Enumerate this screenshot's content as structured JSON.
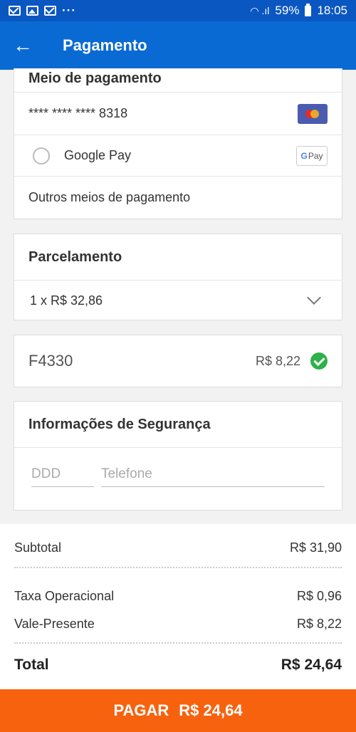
{
  "status_bar": {
    "dots": "···",
    "battery_percent": "59%",
    "time": "18:05"
  },
  "app_bar": {
    "back_icon": "←",
    "title": "Pagamento"
  },
  "payment_methods": {
    "section_title": "Meio de pagamento",
    "card_number": "**** **** **** 8318",
    "card_brand_icon": "mastercard-icon",
    "google_pay_label": "Google Pay",
    "google_pay_badge_g": "G",
    "google_pay_badge_text": "Pay",
    "others_label": "Outros meios de pagamento"
  },
  "installments": {
    "title": "Parcelamento",
    "selected": "1 x R$ 32,86"
  },
  "voucher": {
    "code": "F4330",
    "value": "R$ 8,22",
    "status_color": "#2db14a"
  },
  "security": {
    "title": "Informações de Segurança",
    "ddd_placeholder": "DDD",
    "phone_placeholder": "Telefone"
  },
  "summary": {
    "subtotal_label": "Subtotal",
    "subtotal_value": "R$ 31,90",
    "fee_label": "Taxa Operacional",
    "fee_value": "R$ 0,96",
    "gift_label": "Vale-Presente",
    "gift_value": "R$ 8,22",
    "total_label": "Total",
    "total_value": "R$ 24,64"
  },
  "pay_button": {
    "label": "PAGAR",
    "amount": "R$ 24,64",
    "color": "#f7620f"
  },
  "colors": {
    "primary": "#0a6ad3",
    "status_bar": "#0a57c2",
    "accent": "#f7620f",
    "success": "#2db14a"
  }
}
